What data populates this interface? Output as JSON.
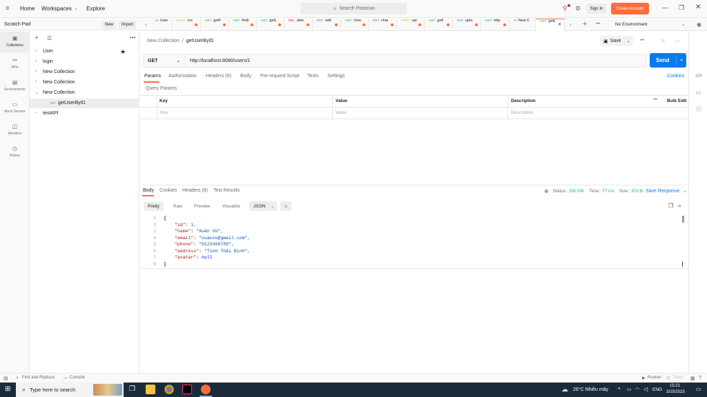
{
  "topbar": {
    "home": "Home",
    "workspaces": "Workspaces",
    "explore": "Explore",
    "search_placeholder": "Search Postman",
    "sign_in": "Sign In",
    "create_account": "Create Account"
  },
  "sidebar": {
    "title": "Scratch Pad",
    "new_label": "New",
    "import_label": "Import",
    "rail": [
      {
        "label": "Collections",
        "icon": "collections-icon",
        "active": true
      },
      {
        "label": "APIs",
        "icon": "apis-icon"
      },
      {
        "label": "Environments",
        "icon": "environments-icon"
      },
      {
        "label": "Mock Servers",
        "icon": "mock-servers-icon"
      },
      {
        "label": "Monitors",
        "icon": "monitors-icon"
      },
      {
        "label": "History",
        "icon": "history-icon"
      }
    ],
    "tree": [
      {
        "label": "User",
        "chev": "›",
        "starred": true
      },
      {
        "label": "login",
        "chev": "›"
      },
      {
        "label": "New Collection",
        "chev": "›"
      },
      {
        "label": "New Collection",
        "chev": "›"
      },
      {
        "label": "New Collection",
        "chev": "⌄"
      },
      {
        "method": "GET",
        "label": "getUserByID",
        "selected": true
      },
      {
        "label": "testAPI",
        "chev": "›"
      }
    ]
  },
  "tabs": [
    {
      "method": "",
      "label": "User"
    },
    {
      "method": "POST",
      "label": "cre"
    },
    {
      "method": "GET",
      "label": "getF"
    },
    {
      "method": "GET",
      "label": "findi"
    },
    {
      "method": "GET",
      "label": "getL"
    },
    {
      "method": "DEL",
      "label": "dele"
    },
    {
      "method": "PUT",
      "label": "edit"
    },
    {
      "method": "GET",
      "label": "chec"
    },
    {
      "method": "PUT",
      "label": "chai"
    },
    {
      "method": "POST",
      "label": "upl"
    },
    {
      "method": "GET",
      "label": "getl"
    },
    {
      "method": "PUT",
      "label": "uplo"
    },
    {
      "method": "GET",
      "label": "http"
    },
    {
      "method": "",
      "label": "New C"
    },
    {
      "method": "GET",
      "label": "getL",
      "active": true
    }
  ],
  "environment": "No Environment",
  "request": {
    "breadcrumb_parent": "New Collection",
    "breadcrumb_sep": "/",
    "breadcrumb_name": "getUserByID",
    "save_label": "Save",
    "method": "GET",
    "url": "http://localhost:8080/users/1",
    "send_label": "Send",
    "tabs": [
      "Params",
      "Authorization",
      "Headers (6)",
      "Body",
      "Pre-request Script",
      "Tests",
      "Settings"
    ],
    "cookies_label": "Cookies",
    "query_params_label": "Query Params",
    "columns": [
      "Key",
      "Value",
      "Description"
    ],
    "bulk_edit": "Bulk Edit",
    "placeholders": {
      "key": "Key",
      "value": "Value",
      "description": "Description"
    }
  },
  "response": {
    "tabs": [
      "Body",
      "Cookies",
      "Headers (8)",
      "Test Results"
    ],
    "status_label": "Status:",
    "status_value": "200 OK",
    "time_label": "Time:",
    "time_value": "77 ms",
    "size_label": "Size:",
    "size_value": "373 B",
    "save_response": "Save Response",
    "views": [
      "Pretty",
      "Raw",
      "Preview",
      "Visualize"
    ],
    "format": "JSON",
    "body_lines": [
      {
        "n": "1",
        "text": "{"
      },
      {
        "n": "2",
        "key": "\"id\"",
        "val": "1,",
        "type": "num"
      },
      {
        "n": "3",
        "key": "\"name\"",
        "val": "\"Xuân Vũ\",",
        "type": "str"
      },
      {
        "n": "4",
        "key": "\"email\"",
        "val": "\"xuanvu@gmail.com\",",
        "type": "str"
      },
      {
        "n": "5",
        "key": "\"phone\"",
        "val": "\"0123456789\",",
        "type": "str"
      },
      {
        "n": "6",
        "key": "\"address\"",
        "val": "\"Tỉnh Thái Bình\",",
        "type": "str"
      },
      {
        "n": "7",
        "key": "\"avatar\"",
        "val": "null",
        "type": "kw"
      },
      {
        "n": "8",
        "text": "}"
      }
    ]
  },
  "statusbar": {
    "find_replace": "Find and Replace",
    "console": "Console",
    "runner": "Runner",
    "trash": "Trash"
  },
  "taskbar": {
    "search": "Type here to search",
    "weather": "26°C  Nhiều mây",
    "lang": "ENG",
    "time": "15:21",
    "date": "3/25/2023"
  },
  "colors": {
    "accent": "#ff6c37",
    "send": "#097bed",
    "link": "#097bed",
    "status_ok": "#0cbb52"
  }
}
